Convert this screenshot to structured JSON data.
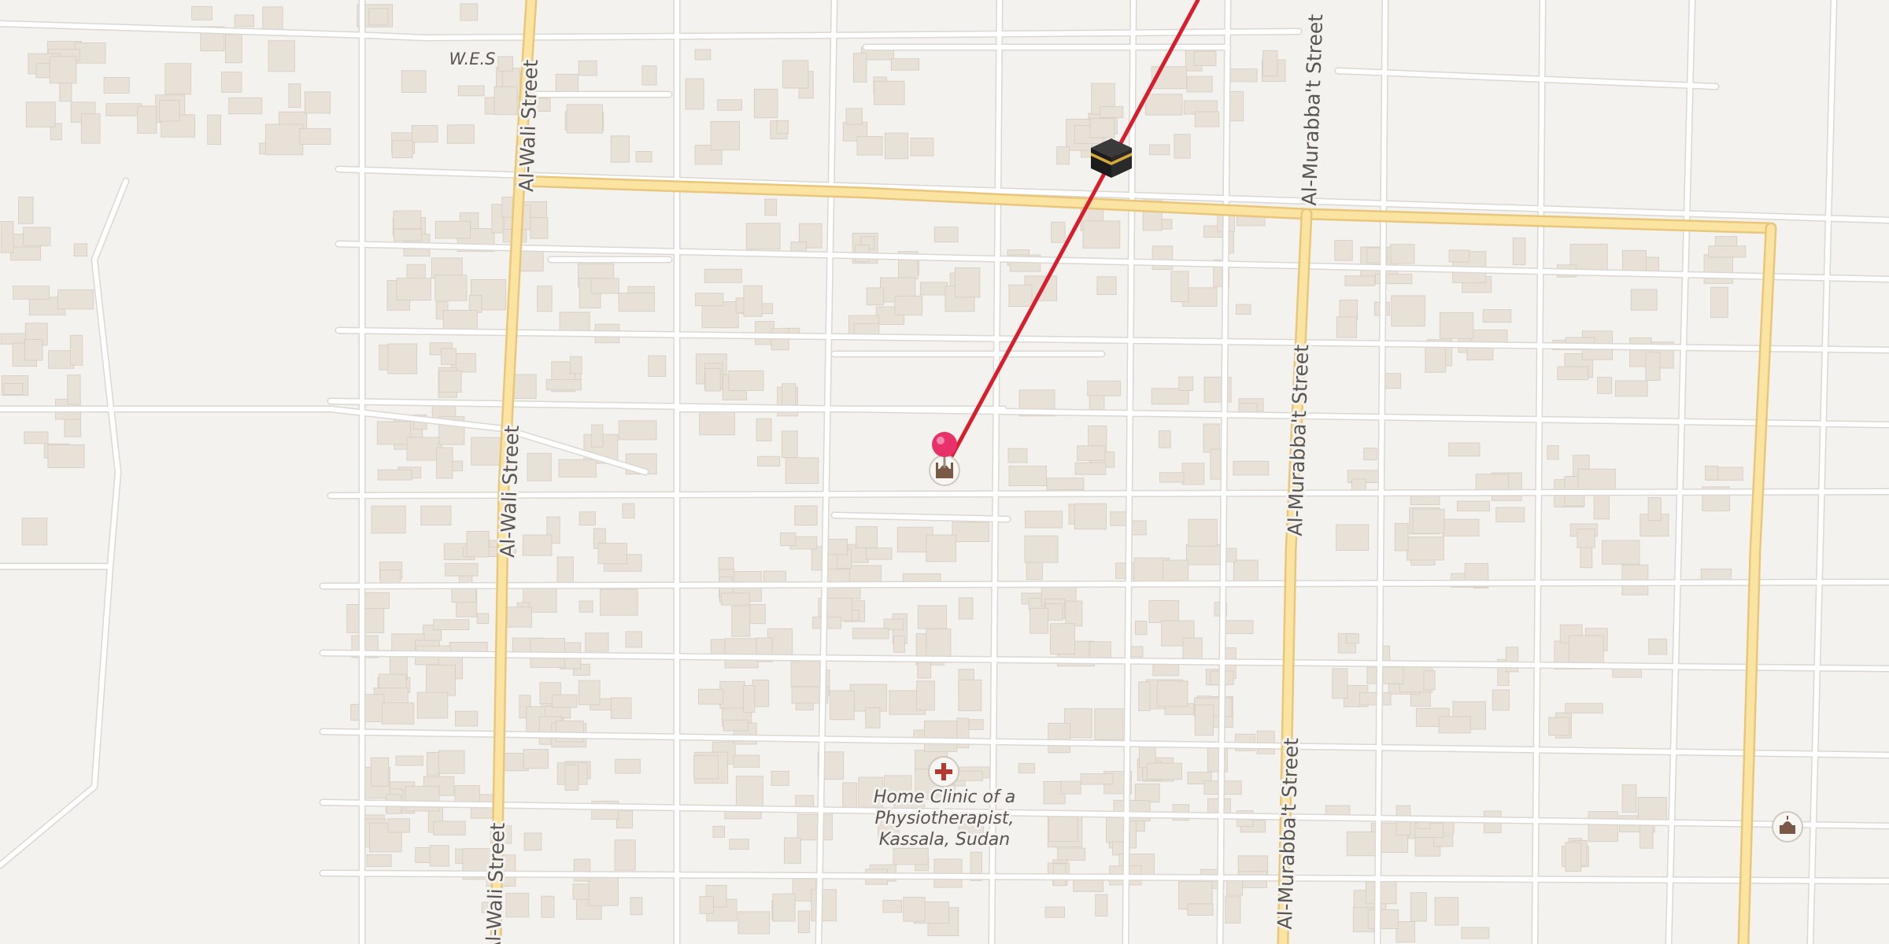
{
  "map": {
    "street_labels": [
      "W.E.S",
      "Al-Wali Street",
      "Al-Murabba't Street"
    ],
    "place_label": "W.E.S",
    "poi": {
      "clinic_name_lines": [
        "Home Clinic of a",
        "Physiotherapist,",
        "Kassala, Sudan"
      ],
      "clinic_icon": "medical-cross-icon",
      "mosque_icon": "mosque-icon",
      "kaaba_icon": "kaaba-icon",
      "pin_icon": "location-pin-icon"
    },
    "colors": {
      "background": "#f4f2ef",
      "minor_road": "#ffffff",
      "road_casing": "#dcd7d0",
      "major_road": "#fbe3a2",
      "major_road_casing": "#e8c77d",
      "building": "#e8e1d8",
      "qibla_line": "#d81e2c",
      "pin": "#e8306a"
    }
  }
}
